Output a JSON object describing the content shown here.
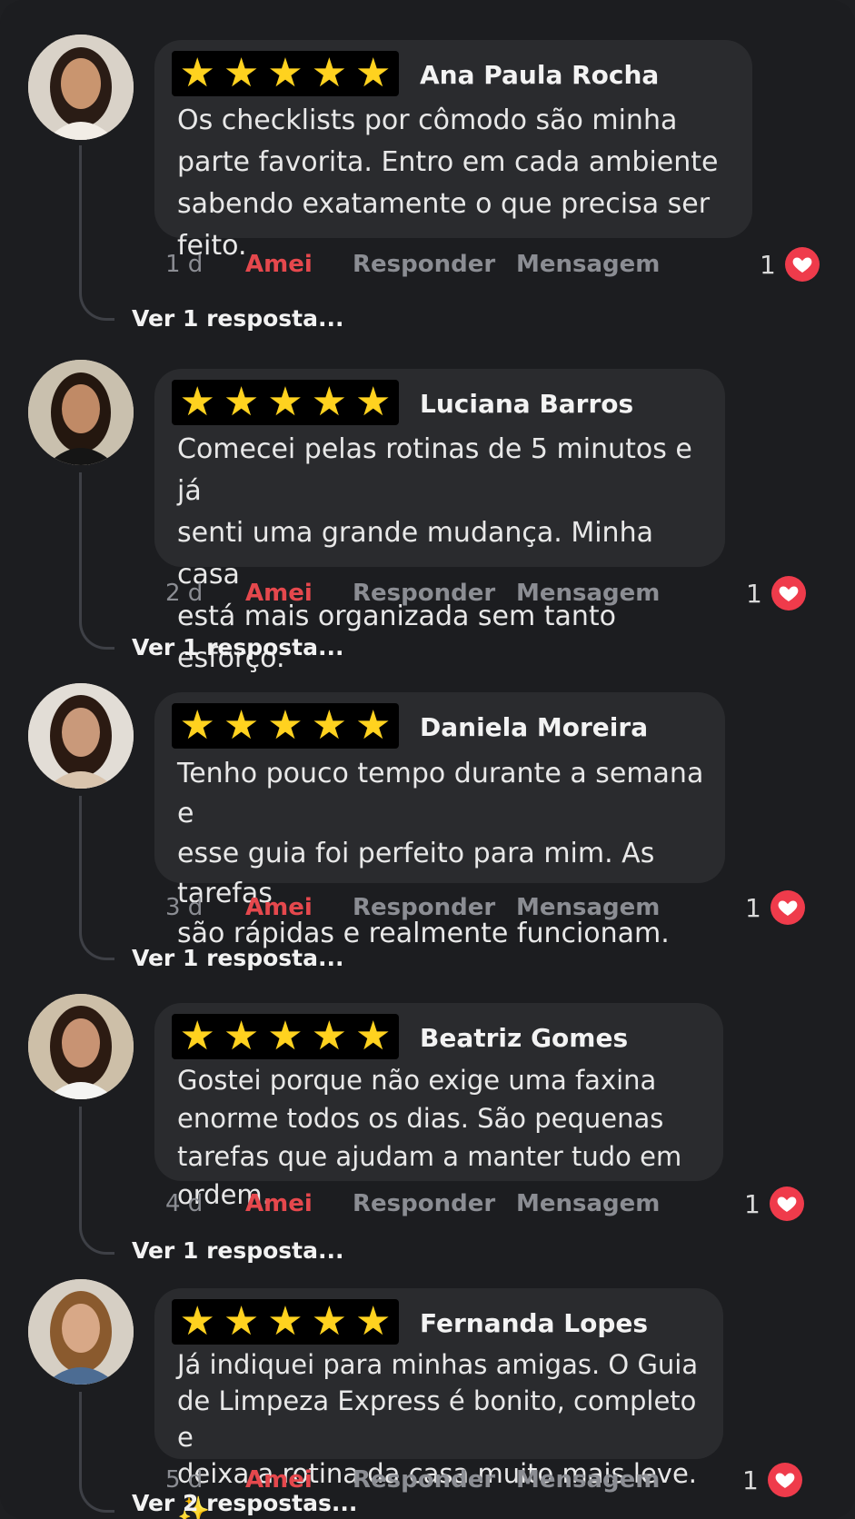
{
  "actions": {
    "love_label": "Amei",
    "reply_label": "Responder",
    "message_label": "Mensagem"
  },
  "colors": {
    "background": "#1c1d20",
    "bubble": "#2a2b2e",
    "stars": "#ffd21f",
    "love_accent": "#e5484d",
    "heart_badge": "#ef3b4b",
    "muted_text": "#8b8d93"
  },
  "comments": [
    {
      "name": "Ana Paula Rocha",
      "rating": 5,
      "text": "Os checklists por cômodo são minha\nparte favorita. Entro em cada ambiente\nsabendo exatamente o que precisa ser feito.",
      "time": "1 d",
      "likes": "1",
      "replies_label": "Ver 1 resposta..."
    },
    {
      "name": "Luciana Barros",
      "rating": 5,
      "text": "Comecei pelas rotinas de 5 minutos e já\nsenti uma grande mudança. Minha casa\nestá mais organizada sem tanto esforço.",
      "time": "2 d",
      "likes": "1",
      "replies_label": "Ver 1 resposta..."
    },
    {
      "name": "Daniela Moreira",
      "rating": 5,
      "text": "Tenho pouco tempo durante a semana e\nesse guia foi perfeito para mim. As tarefas\nsão rápidas e realmente funcionam.",
      "time": "3 d",
      "likes": "1",
      "replies_label": "Ver 1 resposta..."
    },
    {
      "name": "Beatriz Gomes",
      "rating": 5,
      "text": "Gostei porque não exige uma faxina\nenorme todos os dias. São pequenas\ntarefas que ajudam a manter tudo em ordem.",
      "time": "4 d",
      "likes": "1",
      "replies_label": "Ver 1 resposta..."
    },
    {
      "name": "Fernanda Lopes",
      "rating": 5,
      "text": "Já indiquei para minhas amigas. O Guia\nde Limpeza Express é bonito, completo e\ndeixa a rotina da casa muito mais leve. ✨",
      "time": "5 d",
      "likes": "1",
      "replies_label": "Ver 2 respostas..."
    }
  ]
}
